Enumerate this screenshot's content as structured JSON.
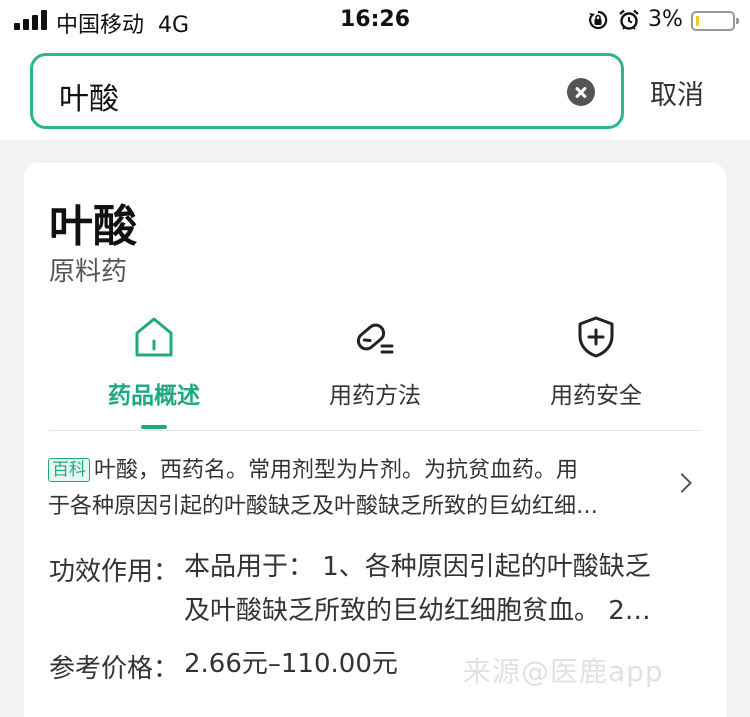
{
  "status_bar": {
    "carrier": "中国移动",
    "network": "4G",
    "time": "16:26",
    "battery_percent": "3%",
    "battery_level": 0.03
  },
  "search": {
    "query": "叶酸",
    "cancel_label": "取消",
    "accent_color": "#2bb58f"
  },
  "drug": {
    "name": "叶酸",
    "type": "原料药"
  },
  "tabs": [
    {
      "label": "药品概述",
      "icon": "home-icon",
      "active": true
    },
    {
      "label": "用药方法",
      "icon": "pill-icon",
      "active": false
    },
    {
      "label": "用药安全",
      "icon": "shield-plus-icon",
      "active": false
    }
  ],
  "summary": {
    "badge": "百科",
    "line1": "叶酸，西药名。常用剂型为片剂。为抗贫血药。用",
    "line2": "于各种原因引起的叶酸缺乏及叶酸缺乏所致的巨幼红细…"
  },
  "details": {
    "effect_label": "功效作用：",
    "effect_line1": "本品用于：  1、各种原因引起的叶酸缺乏",
    "effect_line2": "及叶酸缺乏所致的巨幼红细胞贫血。 2…",
    "price_label": "参考价格：",
    "price_value": "2.66元–110.00元"
  },
  "watermark": "来源@医鹿app"
}
